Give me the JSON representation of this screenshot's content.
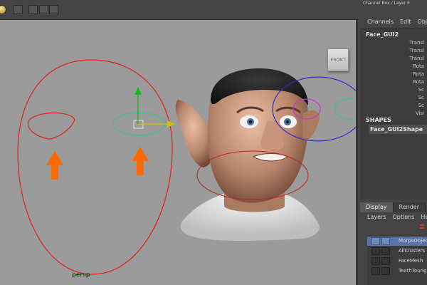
{
  "panel": {
    "title": "Channel Box / Layer E",
    "menu": [
      "Channels",
      "Edit",
      "Object"
    ],
    "node_name": "Face_GUI2",
    "attributes": [
      "Transl",
      "Transl",
      "Transl",
      "Rota",
      "Rota",
      "Rota",
      "Sc",
      "Sc",
      "Sc",
      "Visi"
    ],
    "shapes_header": "SHAPES",
    "shape_name": "Face_GUI2Shape"
  },
  "tabs": [
    "Display",
    "Render"
  ],
  "layer_menu": [
    "Layers",
    "Options",
    "Help"
  ],
  "layers": [
    {
      "visibility": "",
      "name": "MorpsObject",
      "selected": true
    },
    {
      "visibility": "",
      "name": "AllClusters",
      "selected": false
    },
    {
      "visibility": "V",
      "name": "FaceMesh",
      "selected": false
    },
    {
      "visibility": "V",
      "name": "TeathToung",
      "selected": false
    }
  ],
  "viewport": {
    "camera": "persp",
    "viewcube_face": "FRONT"
  },
  "colors": {
    "viewport_bg": "#9b9b9b",
    "gui_curve": "#e02020",
    "arrow": "#ff6a00",
    "slider_ring": "#40c090",
    "blue_ring": "#2a2ad0",
    "pink_ring": "#cc33cc",
    "selected_layer": "#5874a4"
  }
}
